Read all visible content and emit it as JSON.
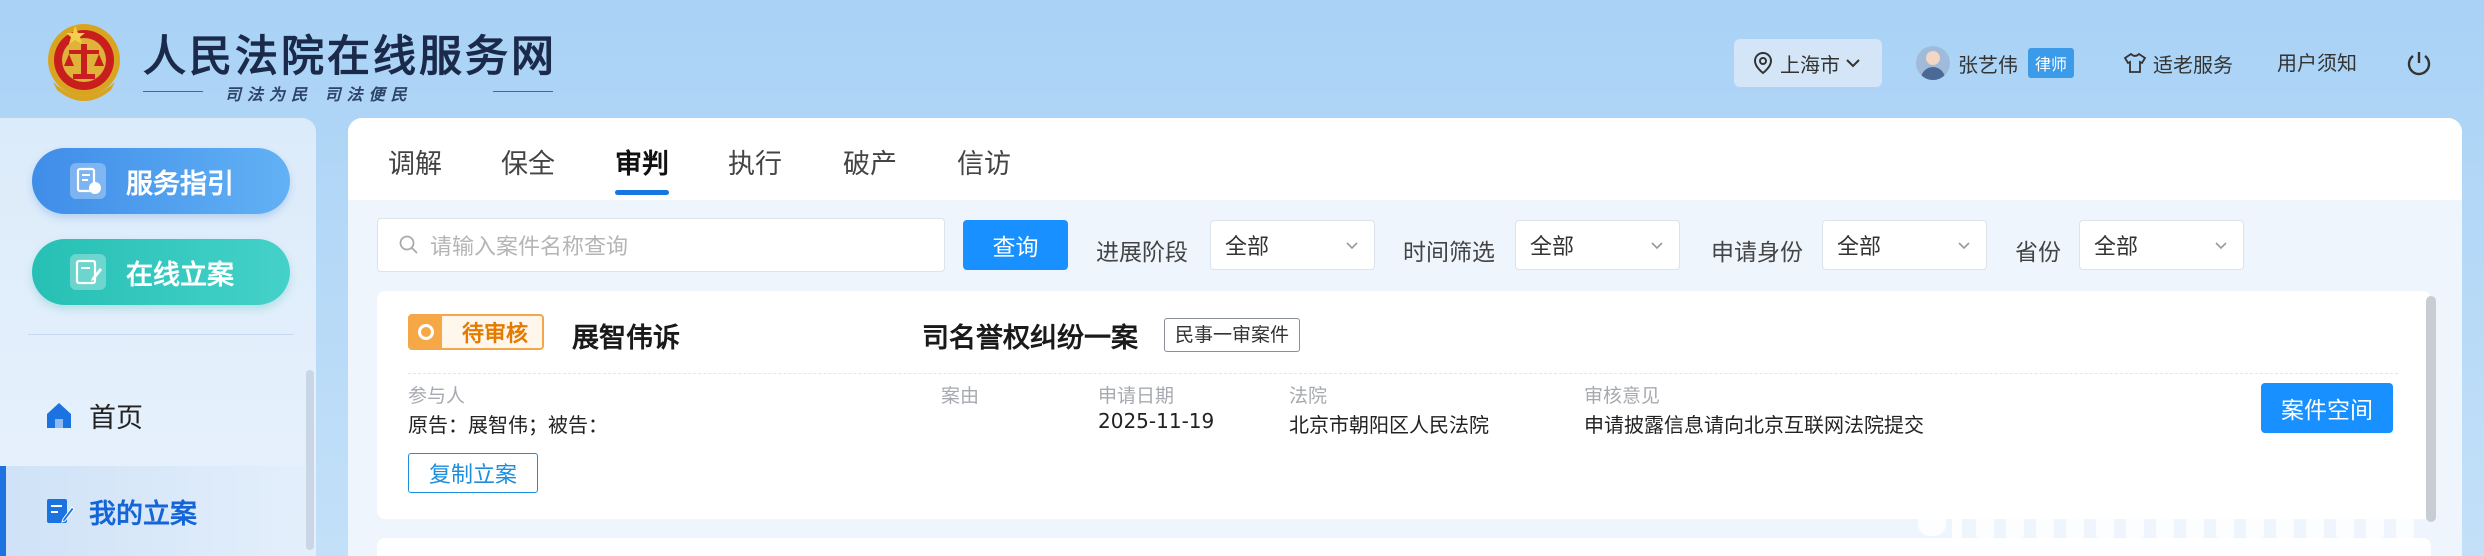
{
  "header": {
    "site_title": "人民法院在线服务网",
    "slogan": "司法为民 司法便民",
    "city": "上海市",
    "user_name": "张艺伟",
    "user_role": "律师",
    "elder_service": "适老服务",
    "user_notice": "用户须知"
  },
  "sidebar": {
    "guide_label": "服务指引",
    "file_label": "在线立案",
    "home_label": "首页",
    "mine_label": "我的立案"
  },
  "tabs": [
    "调解",
    "保全",
    "审判",
    "执行",
    "破产",
    "信访"
  ],
  "active_tab": "审判",
  "search": {
    "placeholder": "请输入案件名称查询",
    "button": "查询"
  },
  "filters": [
    {
      "label": "进展阶段",
      "value": "全部"
    },
    {
      "label": "时间筛选",
      "value": "全部"
    },
    {
      "label": "申请身份",
      "value": "全部"
    },
    {
      "label": "省份",
      "value": "全部"
    }
  ],
  "case": {
    "status": "待审核",
    "title_start": "展智伟诉",
    "title_end": "司名誉权纠纷一案",
    "type": "民事一审案件",
    "participants_label": "参与人",
    "participants_value": "原告：展智伟；被告：",
    "cause_label": "案由",
    "date_label": "申请日期",
    "date_value": "2025-11-19",
    "court_label": "法院",
    "court_value": "北京市朝阳区人民法院",
    "opinion_label": "审核意见",
    "opinion_value": "申请披露信息请向北京互联网法院提交",
    "copy_button": "复制立案",
    "space_button": "案件空间"
  },
  "colors": {
    "primary": "#1890ff",
    "status_orange": "#f4a64b",
    "guide_blue": "#3f8de8",
    "file_teal": "#27c0b4"
  }
}
